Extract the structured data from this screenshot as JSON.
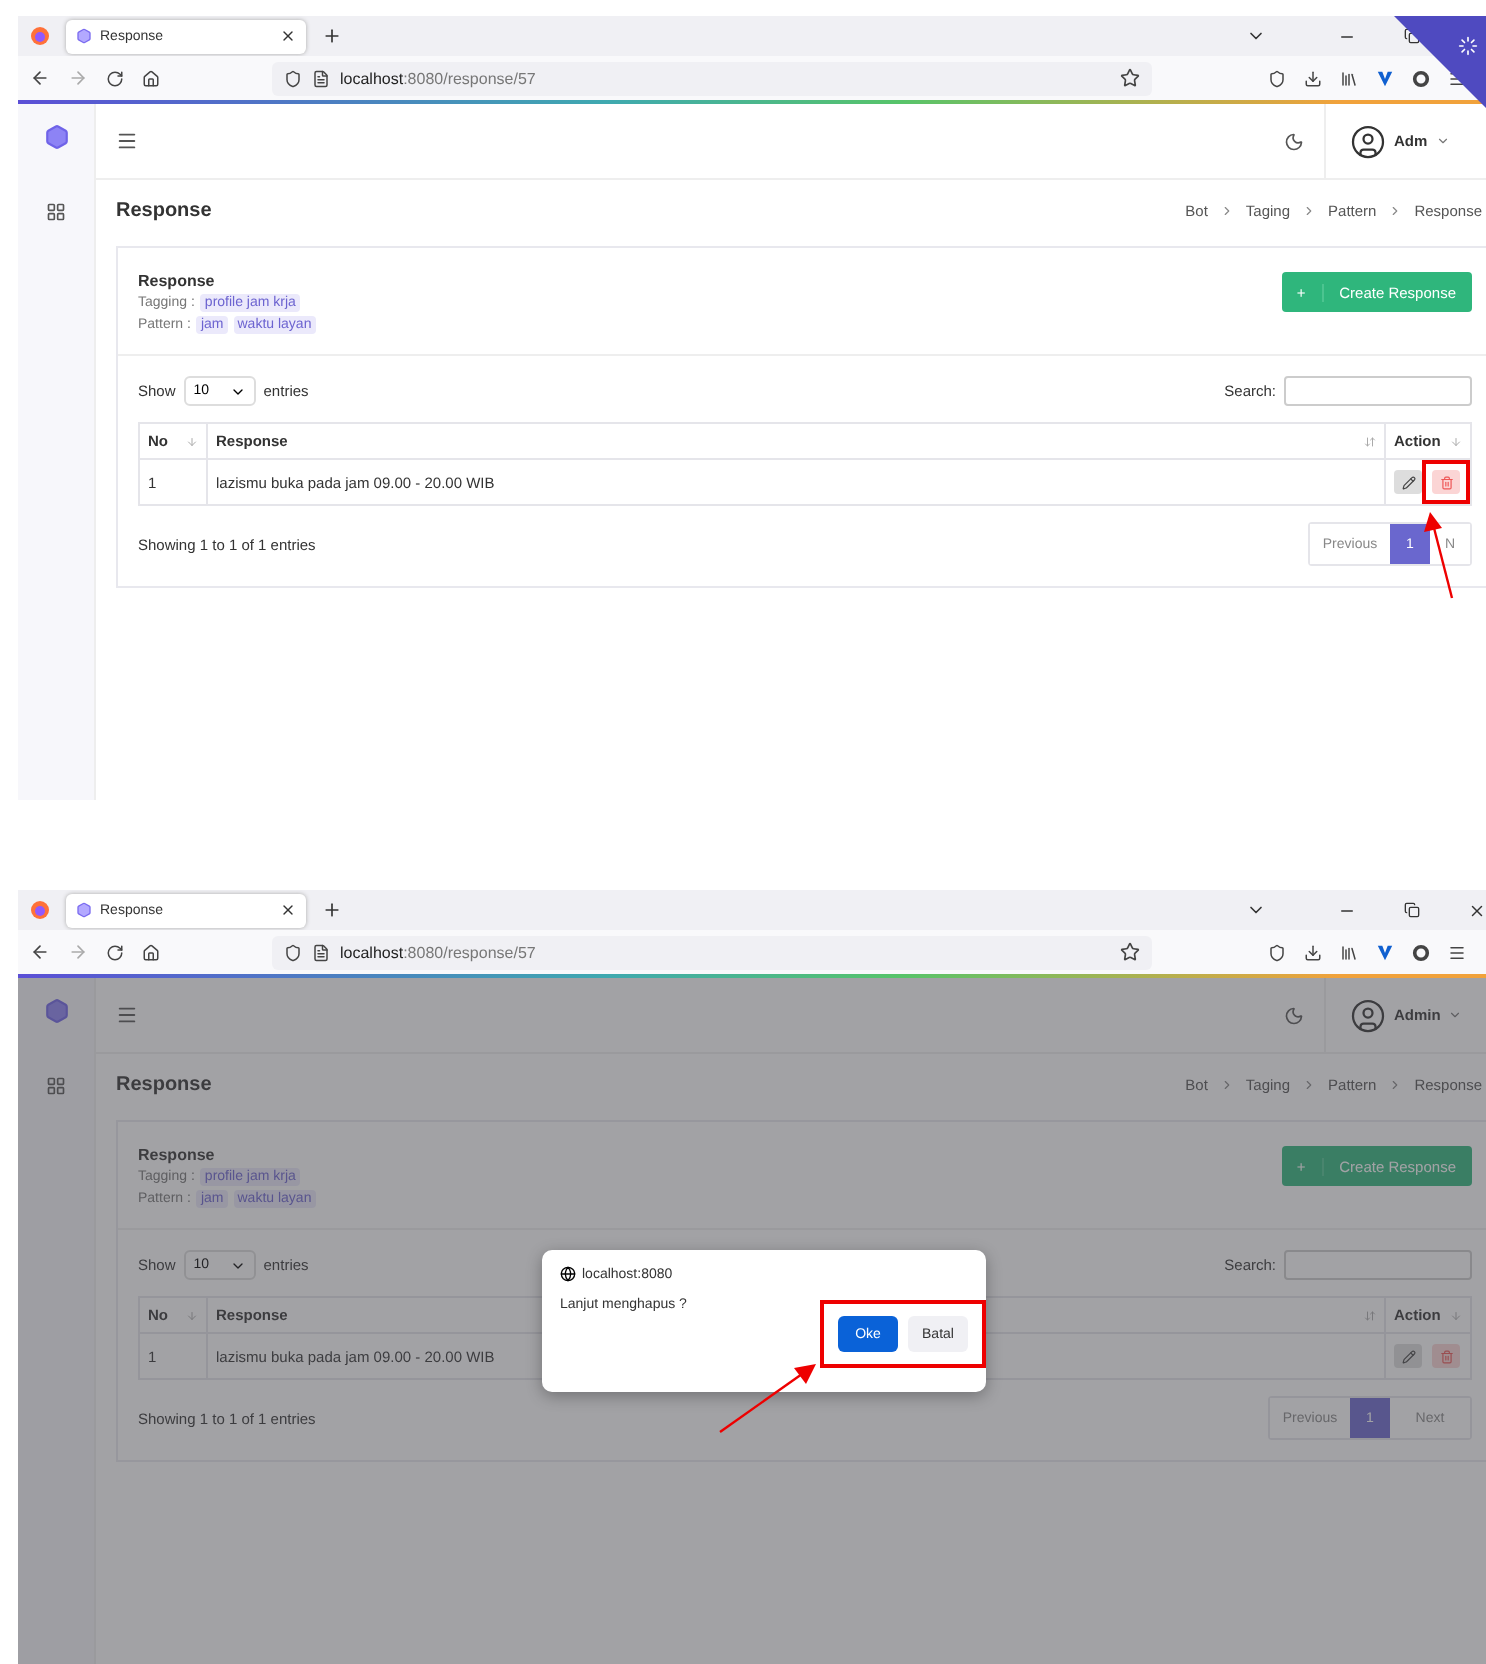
{
  "panels": [
    {
      "browser": {
        "tab_title": "Response",
        "url_host": "localhost",
        "url_rest": ":8080/response/57"
      },
      "loading": true,
      "user": "Adm",
      "page_title": "Response",
      "breadcrumbs": [
        "Bot",
        "Taging",
        "Pattern",
        "Response"
      ],
      "card": {
        "title": "Response",
        "tagging_label": "Tagging :",
        "tagging_tags": [
          "profile jam krja"
        ],
        "pattern_label": "Pattern :",
        "pattern_tags": [
          "jam",
          "waktu layan"
        ],
        "create_button": "Create Response",
        "plus": "+"
      },
      "table": {
        "show_label": "Show",
        "entries_value": "10",
        "entries_label": "entries",
        "search_label": "Search:",
        "columns": [
          "No",
          "Response",
          "Action"
        ],
        "rows": [
          [
            "1",
            "lazismu buka pada jam 09.00 - 20.00 WIB"
          ]
        ],
        "info": "Showing 1 to 1 of 1 entries"
      },
      "pagination": [
        {
          "label": "Previous",
          "selected": false
        },
        {
          "label": "1",
          "selected": true
        },
        {
          "label": "N",
          "selected": false
        }
      ],
      "annotation": {
        "kind": "delete"
      }
    },
    {
      "browser": {
        "tab_title": "Response",
        "url_host": "localhost",
        "url_rest": ":8080/response/57"
      },
      "user": "Admin",
      "page_title": "Response",
      "breadcrumbs": [
        "Bot",
        "Taging",
        "Pattern",
        "Response"
      ],
      "card": {
        "title": "Response",
        "tagging_label": "Tagging :",
        "tagging_tags": [
          "profile jam krja"
        ],
        "pattern_label": "Pattern :",
        "pattern_tags": [
          "jam",
          "waktu layan"
        ],
        "create_button": "Create Response",
        "plus": "+"
      },
      "table": {
        "show_label": "Show",
        "entries_value": "10",
        "entries_label": "entries",
        "search_label": "Search:",
        "columns": [
          "No",
          "Response",
          "Action"
        ],
        "rows": [
          [
            "1",
            "lazismu buka pada jam 09.00 - 20.00 WIB"
          ]
        ],
        "info": "Showing 1 to 1 of 1 entries"
      },
      "pagination": [
        {
          "label": "Previous",
          "selected": false
        },
        {
          "label": "1",
          "selected": true
        },
        {
          "label": "Next",
          "selected": false
        }
      ],
      "dialog": {
        "host": "localhost:8080",
        "message": "Lanjut menghapus ?",
        "buttons": [
          {
            "label": "Oke",
            "primary": true
          },
          {
            "label": "Batal",
            "primary": false
          }
        ]
      },
      "annotation": {
        "kind": "dialog"
      }
    }
  ]
}
